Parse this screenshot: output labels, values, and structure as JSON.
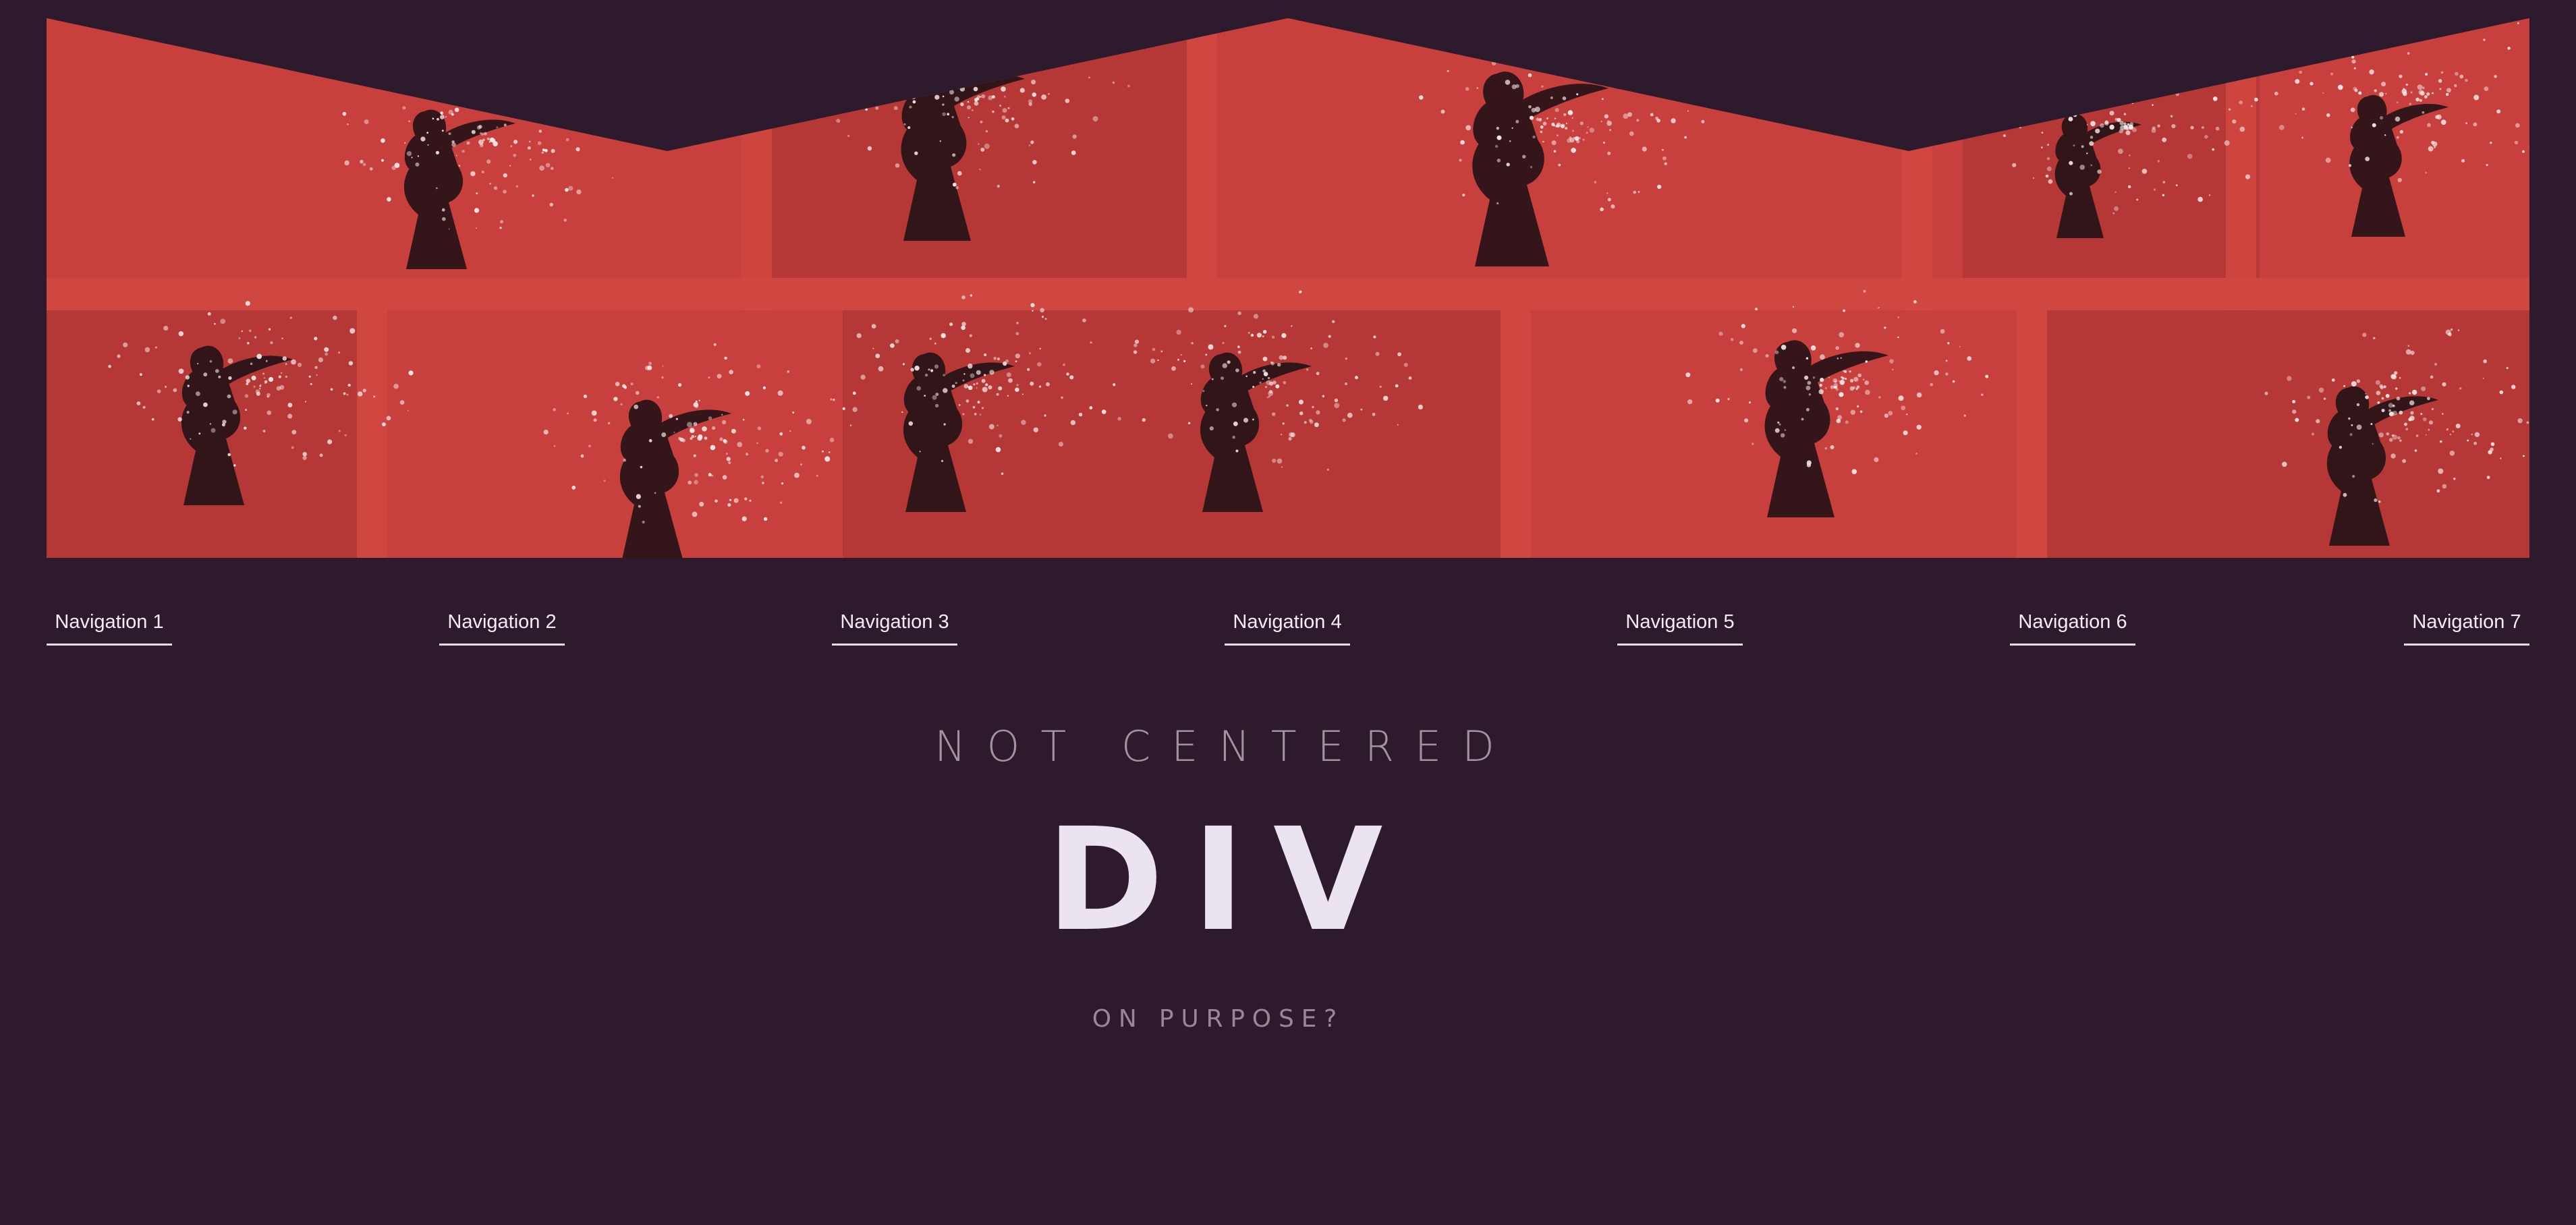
{
  "colors": {
    "background": "#2d1b2d",
    "banner_red": "#c7403d",
    "banner_red_dark": "#b63836",
    "banner_red_light": "#d04741",
    "figure_dark": "#1a0f14",
    "speck": "#f2e6e6",
    "nav_text": "#f3eef2",
    "title_text": "#ece3f0"
  },
  "banner": {
    "image_icon": "woman-dispersing-particles-image"
  },
  "navigation": {
    "items": [
      {
        "label": "Navigation 1"
      },
      {
        "label": "Navigation 2"
      },
      {
        "label": "Navigation 3"
      },
      {
        "label": "Navigation 4"
      },
      {
        "label": "Navigation 5"
      },
      {
        "label": "Navigation 6"
      },
      {
        "label": "Navigation 7"
      }
    ]
  },
  "hero": {
    "subtitle": "NOT CENTERED",
    "title": "DIV",
    "tagline": "ON PURPOSE?"
  }
}
